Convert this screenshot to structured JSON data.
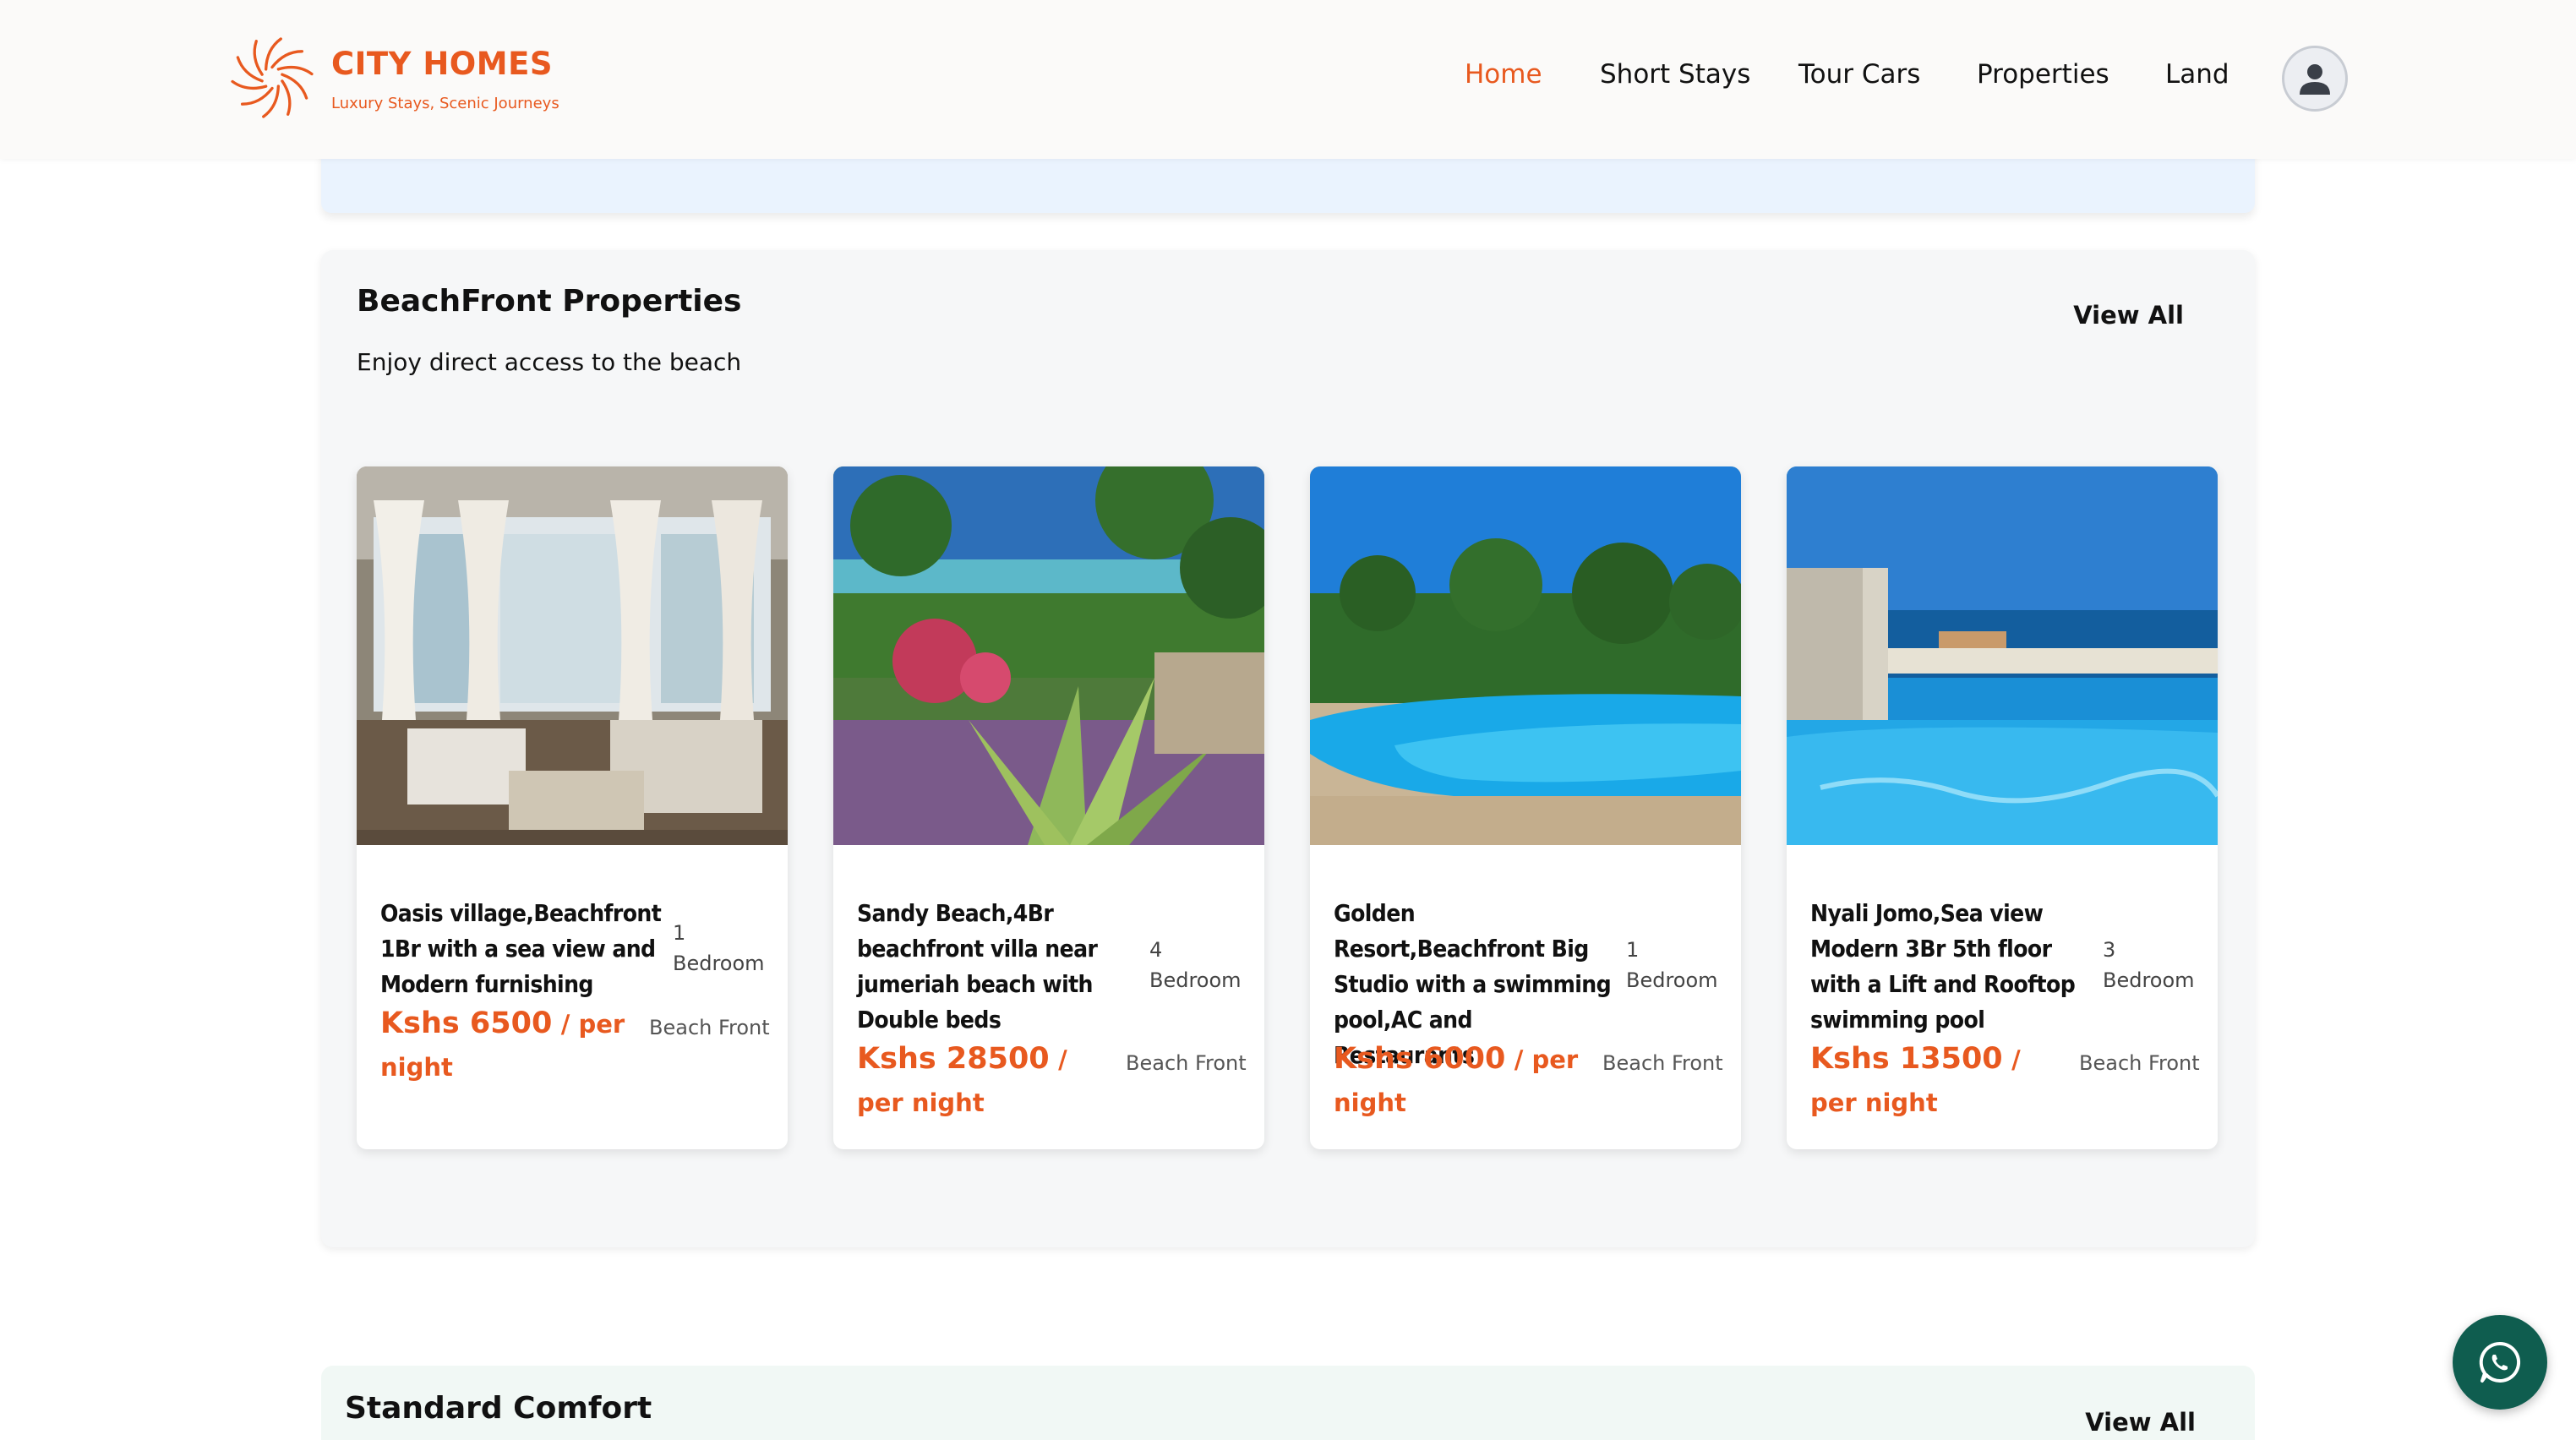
{
  "brand": {
    "name": "CITY HOMES",
    "tagline": "Luxury Stays, Scenic Journeys",
    "logo_icon": "swirl-sun-logo",
    "accent_color": "#e8591f"
  },
  "nav": {
    "items": [
      {
        "label": "Home",
        "active": true
      },
      {
        "label": "Short Stays",
        "active": false
      },
      {
        "label": "Tour Cars",
        "active": false
      },
      {
        "label": "Properties",
        "active": false
      },
      {
        "label": "Land",
        "active": false
      }
    ],
    "profile_icon": "user-avatar-icon"
  },
  "section": {
    "title": "BeachFront Properties",
    "subtitle": "Enjoy direct access to the beach",
    "view_all": "View All",
    "cards": [
      {
        "title": "Oasis village,Beachfront 1Br with a sea view and Modern furnishing",
        "beds_count": "1",
        "beds_label": "Bedroom",
        "price": "Kshs 6500",
        "price_unit": "/ per night",
        "type": "Beach Front",
        "image": "living-room-with-curtains"
      },
      {
        "title": "Sandy Beach,4Br beachfront villa near jumeriah beach with Double beds",
        "beds_count": "4",
        "beds_label": "Bedroom",
        "price": "Kshs 28500",
        "price_unit": "/ per night",
        "type": "Beach Front",
        "image": "tropical-garden-beach-path"
      },
      {
        "title": "Golden Resort,Beachfront Big Studio with a swimming pool,AC and Restaurants",
        "beds_count": "1",
        "beds_label": "Bedroom",
        "price": "Kshs 6000",
        "price_unit": "/ per night",
        "type": "Beach Front",
        "image": "resort-pool-palms"
      },
      {
        "title": "Nyali Jomo,Sea view Modern 3Br 5th floor with a Lift and Rooftop swimming pool",
        "beds_count": "3",
        "beds_label": "Bedroom",
        "price": "Kshs 13500",
        "price_unit": "/ per night",
        "type": "Beach Front",
        "image": "rooftop-pool-ocean-view"
      }
    ]
  },
  "next_section": {
    "title": "Standard Comfort",
    "view_all": "View All"
  },
  "whatsapp": {
    "icon": "whatsapp-icon",
    "color": "#0f5d4f"
  }
}
